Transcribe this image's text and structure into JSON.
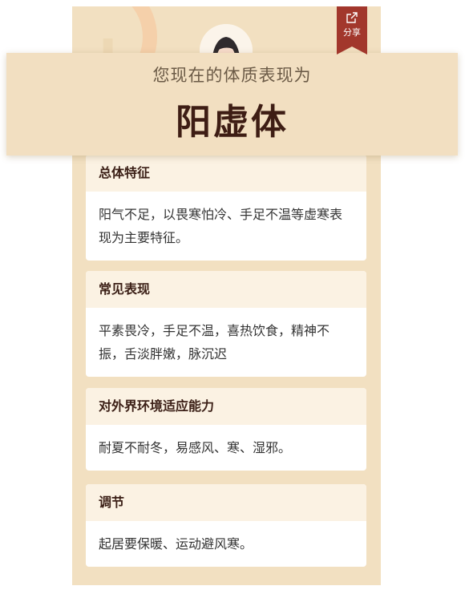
{
  "header": {
    "share_label": "分享",
    "subtitle": "您现在的体质表现为",
    "title": "阳虚体"
  },
  "sections": [
    {
      "heading": "总体特征",
      "body": "阳气不足，以畏寒怕冷、手足不温等虚寒表现为主要特征。"
    },
    {
      "heading": "常见表现",
      "body": "平素畏冷，手足不温，喜热饮食，精神不振，舌淡胖嫩，脉沉迟"
    },
    {
      "heading": "对外界环境适应能力",
      "body": "耐夏不耐冬，易感风、寒、湿邪。"
    },
    {
      "heading": "调节",
      "body": "起居要保暖、运动避风寒。"
    }
  ],
  "icons": {
    "share": "share-icon",
    "avatar": "avatar"
  },
  "colors": {
    "accent": "#a2372c",
    "background": "#f2e0c1",
    "title": "#3e1d14"
  }
}
